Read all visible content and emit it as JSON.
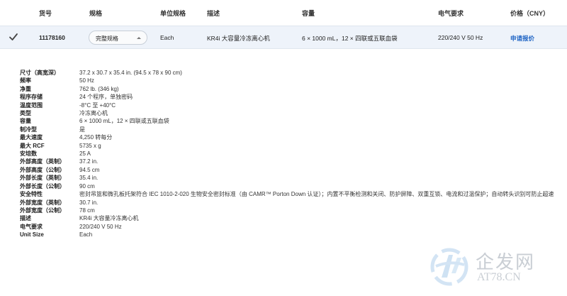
{
  "table": {
    "headers": {
      "item_no": "货号",
      "spec": "规格",
      "unit_spec": "单位规格",
      "description": "描述",
      "capacity": "容量",
      "electrical": "电气要求",
      "price": "价格（CNY）"
    },
    "row": {
      "item_no": "11178160",
      "spec_selected": "完整规格",
      "unit": "Each",
      "description": "KR4i 大容量冷冻离心机",
      "capacity": "6 × 1000 mL，12 × 四联或五联血袋",
      "electrical": "220/240 V 50 Hz",
      "price_link": "申请报价"
    }
  },
  "specs": [
    {
      "label": "尺寸（高宽深）",
      "value": "37.2 x 30.7 x 35.4 in. (94.5 x 78 x 90 cm)"
    },
    {
      "label": "频率",
      "value": "50 Hz"
    },
    {
      "label": "净重",
      "value": "762 lb. (346 kg)"
    },
    {
      "label": "程序存储",
      "value": "24 个程序，单独密码"
    },
    {
      "label": "温度范围",
      "value": "-8°C 至 +40°C"
    },
    {
      "label": "类型",
      "value": "冷冻离心机"
    },
    {
      "label": "容量",
      "value": "6 × 1000 mL，12 × 四联或五联血袋"
    },
    {
      "label": "制冷型",
      "value": "是"
    },
    {
      "label": "最大速度",
      "value": "4,250 转每分"
    },
    {
      "label": "最大 RCF",
      "value": "5735 x g"
    },
    {
      "label": "安培数",
      "value": "25 A"
    },
    {
      "label": "外部高度（英制）",
      "value": "37.2 in."
    },
    {
      "label": "外部高度（公制）",
      "value": "94.5 cm"
    },
    {
      "label": "外部长度（英制）",
      "value": "35.4 in."
    },
    {
      "label": "外部长度（公制）",
      "value": "90 cm"
    },
    {
      "label": "安全特性",
      "value": "密封吊篮和微孔板托架符合 IEC 1010-2-020 生物安全密封标准（由 CAMR™ Porton Down 认证）；内置不平衡检测和关闭、防护屏障、双重互锁、电流和过温保护；自动转头识别可防止超速"
    },
    {
      "label": "外部宽度（英制）",
      "value": "30.7 in."
    },
    {
      "label": "外部宽度（公制）",
      "value": "78 cm"
    },
    {
      "label": "描述",
      "value": "KR4i 大容量冷冻离心机"
    },
    {
      "label": "电气要求",
      "value": "220/240 V 50 Hz"
    },
    {
      "label": "Unit Size",
      "value": "Each"
    }
  ],
  "watermark": {
    "cn": "企发网",
    "en": "AT78.CN"
  },
  "colors": {
    "row_bg": "#eef3fa",
    "link": "#1d63c4",
    "watermark": "#c9ced4"
  }
}
